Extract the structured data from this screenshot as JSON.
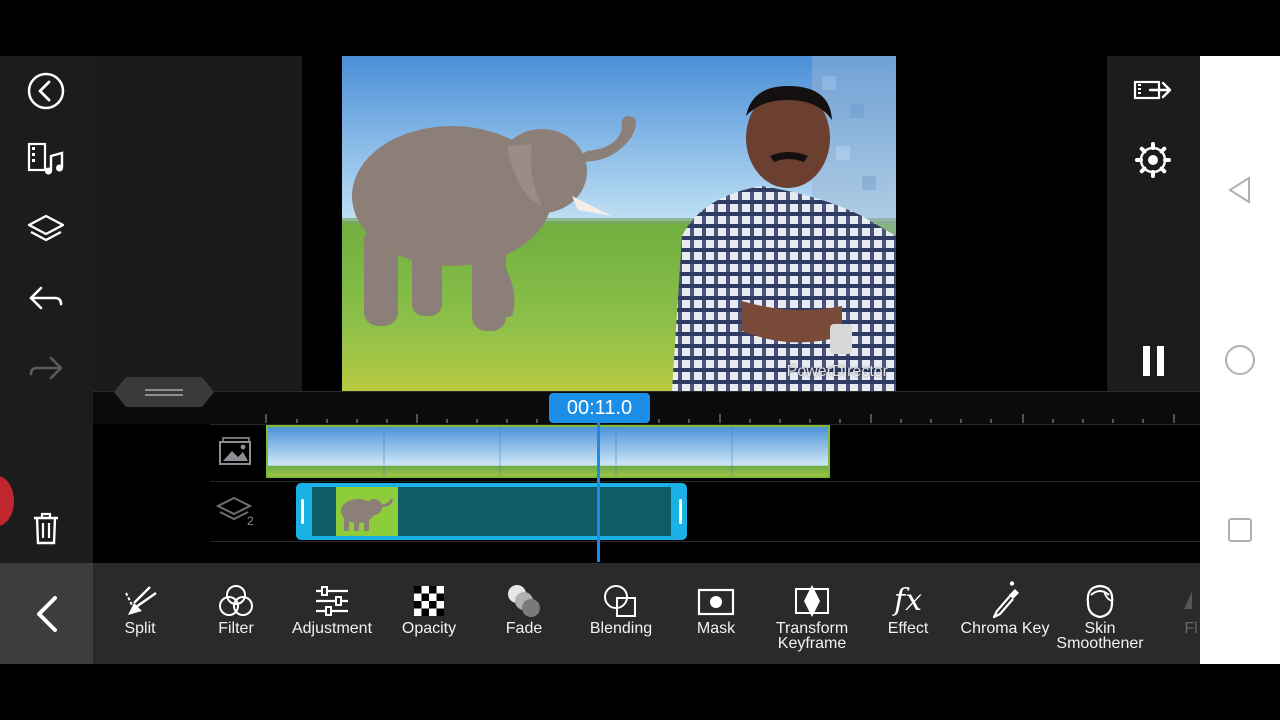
{
  "app": {
    "watermark": "PowerDirector"
  },
  "left_rail": {
    "items": [
      {
        "name": "back",
        "icon": "back-circle-icon"
      },
      {
        "name": "media",
        "icon": "media-music-icon"
      },
      {
        "name": "layers",
        "icon": "layers-icon"
      },
      {
        "name": "undo",
        "icon": "undo-icon"
      },
      {
        "name": "redo",
        "icon": "redo-icon"
      },
      {
        "name": "delete",
        "icon": "trash-icon"
      }
    ]
  },
  "right_rail": {
    "items": [
      {
        "name": "export",
        "icon": "export-icon"
      },
      {
        "name": "settings",
        "icon": "gear-icon"
      },
      {
        "name": "pause",
        "icon": "pause-icon"
      }
    ]
  },
  "timeline": {
    "current_time": "00:11.0",
    "overlay_track_number": "2"
  },
  "toolbar": {
    "tools": [
      {
        "id": "split",
        "label": "Split"
      },
      {
        "id": "filter",
        "label": "Filter"
      },
      {
        "id": "adjustment",
        "label": "Adjustment"
      },
      {
        "id": "opacity",
        "label": "Opacity"
      },
      {
        "id": "fade",
        "label": "Fade"
      },
      {
        "id": "blending",
        "label": "Blending"
      },
      {
        "id": "mask",
        "label": "Mask"
      },
      {
        "id": "transform-keyframe",
        "label": "Transform Keyframe"
      },
      {
        "id": "effect",
        "label": "Effect"
      },
      {
        "id": "chroma-key",
        "label": "Chroma Key"
      },
      {
        "id": "skin-smoothener",
        "label": "Skin Smoothener"
      },
      {
        "id": "flip",
        "label": "Fl"
      }
    ]
  },
  "colors": {
    "accent_blue": "#1b8fe8",
    "overlay_clip_border": "#1ab2e6",
    "overlay_clip_fill": "#0e5c66",
    "video_clip_border": "#7ebc37",
    "toolbar_bg": "#2a2a2d",
    "rail_bg": "#1c1c1e"
  }
}
